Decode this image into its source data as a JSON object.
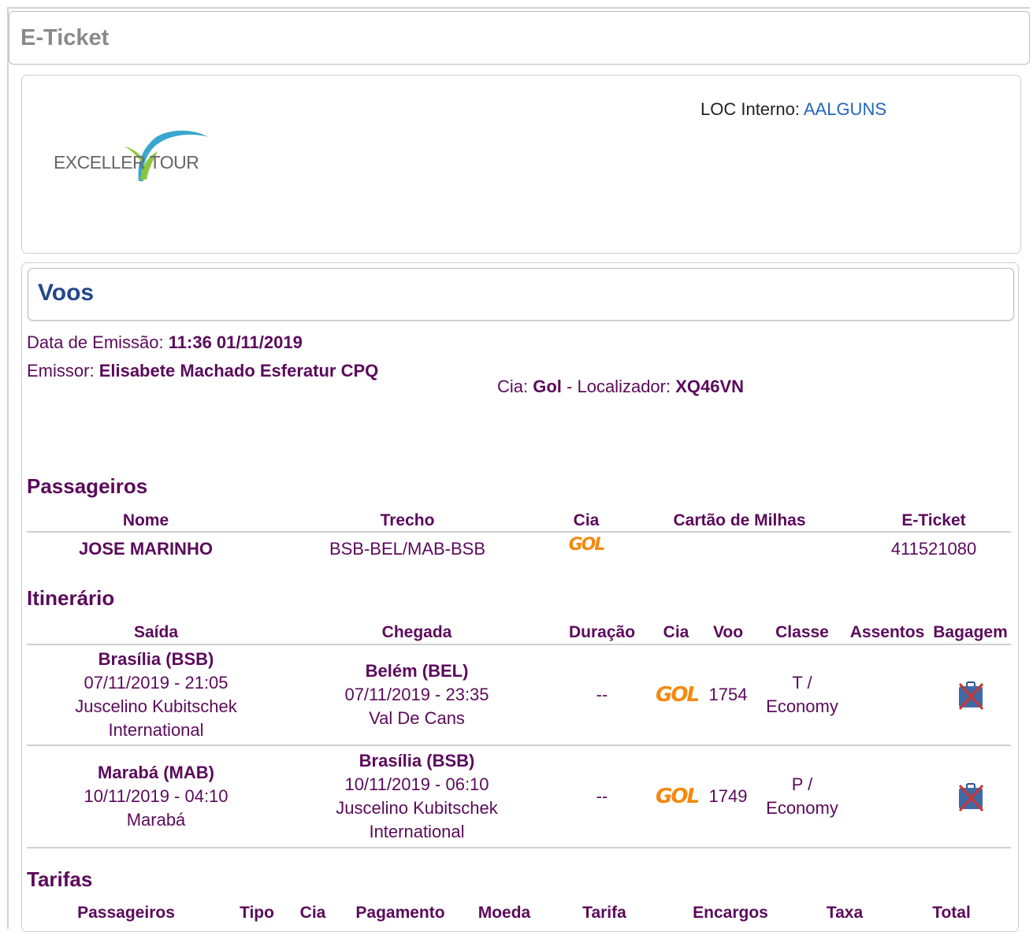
{
  "window": {
    "title": "E-Ticket"
  },
  "header": {
    "logo_text": "EXCELLER TOUR",
    "loc_label": "LOC Interno:",
    "loc_value": "AALGUNS"
  },
  "voos": {
    "title": "Voos",
    "emissao_label": "Data de Emissão:",
    "emissao_value": "11:36 01/11/2019",
    "emissor_label": "Emissor:",
    "emissor_value": "Elisabete Machado Esferatur CPQ",
    "cia_label": "Cia:",
    "cia_value": "Gol",
    "loc_sep": " - Localizador:",
    "localizador_value": "XQ46VN"
  },
  "passageiros": {
    "title": "Passageiros",
    "headers": [
      "Nome",
      "Trecho",
      "Cia",
      "Cartão de Milhas",
      "E-Ticket"
    ],
    "rows": [
      {
        "nome": "JOSE MARINHO",
        "trecho": "BSB-BEL/MAB-BSB",
        "cia_logo": "GOL",
        "cartao": "",
        "eticket": "411521080"
      }
    ]
  },
  "itinerario": {
    "title": "Itinerário",
    "headers": [
      "Saída",
      "Chegada",
      "Duração",
      "Cia",
      "Voo",
      "Classe",
      "Assentos",
      "Bagagem"
    ],
    "rows": [
      {
        "saida_city": "Brasília (BSB)",
        "saida_dt": "07/11/2019 - 21:05",
        "saida_airport_1": "Juscelino Kubitschek",
        "saida_airport_2": "International",
        "chegada_city": "Belém (BEL)",
        "chegada_dt": "07/11/2019 - 23:35",
        "chegada_airport_1": "Val De Cans",
        "chegada_airport_2": "",
        "duracao": "--",
        "cia_logo": "GOL",
        "voo": "1754",
        "classe_1": "T /",
        "classe_2": "Economy",
        "assentos": "",
        "bagagem_icon": "no-baggage-icon"
      },
      {
        "saida_city": "Marabá (MAB)",
        "saida_dt": "10/11/2019 - 04:10",
        "saida_airport_1": "Marabá",
        "saida_airport_2": "",
        "chegada_city": "Brasília (BSB)",
        "chegada_dt": "10/11/2019 - 06:10",
        "chegada_airport_1": "Juscelino Kubitschek",
        "chegada_airport_2": "International",
        "duracao": "--",
        "cia_logo": "GOL",
        "voo": "1749",
        "classe_1": "P /",
        "classe_2": "Economy",
        "assentos": "",
        "bagagem_icon": "no-baggage-icon"
      }
    ]
  },
  "tarifas": {
    "title": "Tarifas",
    "headers": [
      "Passageiros",
      "Tipo",
      "Cia",
      "Pagamento",
      "Moeda",
      "Tarifa",
      "Encargos",
      "Taxa",
      "Total"
    ]
  },
  "colors": {
    "text": "#5b0a5b",
    "voos_title": "#24468a",
    "link": "#2266bb",
    "gol_orange": "#f28a10"
  }
}
